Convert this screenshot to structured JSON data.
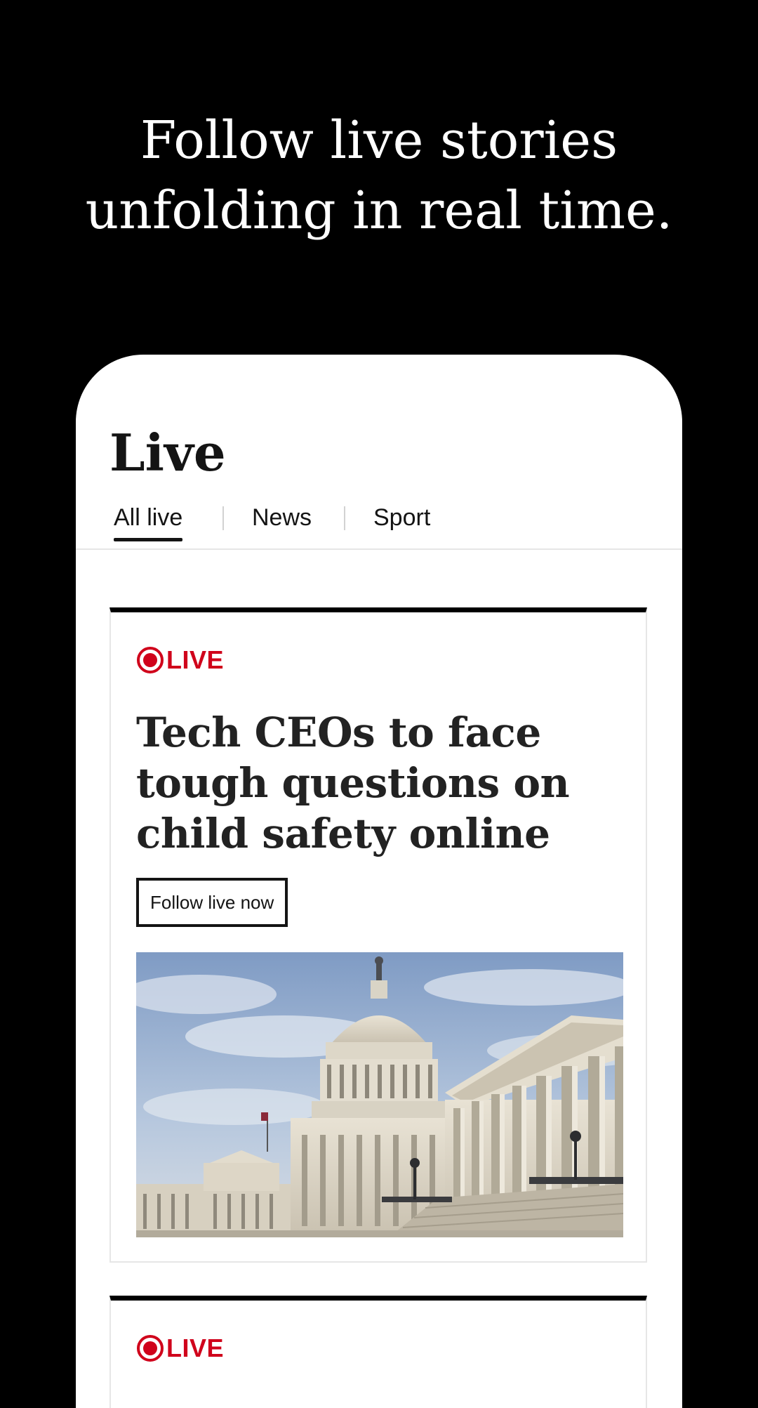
{
  "promo": {
    "headline_line1": "Follow live stories",
    "headline_line2": "unfolding in real time."
  },
  "app": {
    "page_title": "Live",
    "tabs": [
      {
        "label": "All live",
        "active": true
      },
      {
        "label": "News",
        "active": false
      },
      {
        "label": "Sport",
        "active": false
      }
    ]
  },
  "cards": [
    {
      "badge": "LIVE",
      "title": "Tech CEOs to face tough questions on child safety online",
      "button_label": "Follow live now",
      "image_icon": "capitol-building-photo"
    },
    {
      "badge": "LIVE"
    }
  ],
  "colors": {
    "live_red": "#d0021b",
    "background": "#000000",
    "card_bg": "#ffffff",
    "text_dark": "#141414"
  }
}
